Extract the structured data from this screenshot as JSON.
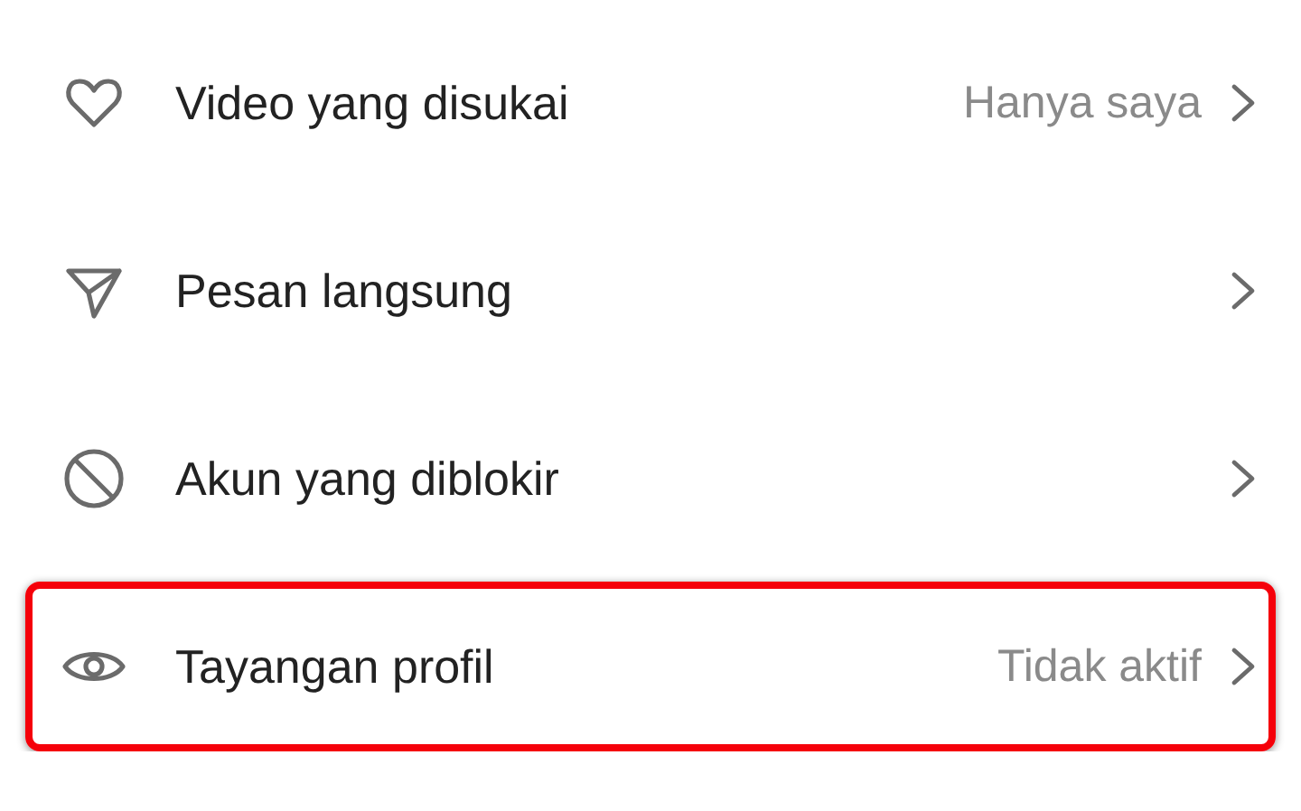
{
  "settings_items": [
    {
      "kind": "heart",
      "label": "Video yang disukai",
      "value": "Hanya saya",
      "highlighted": false
    },
    {
      "kind": "send",
      "label": "Pesan langsung",
      "highlighted": false
    },
    {
      "kind": "block",
      "label": "Akun yang diblokir",
      "highlighted": false
    },
    {
      "kind": "eye",
      "label": "Tayangan profil",
      "value": "Tidak aktif",
      "highlighted": true
    }
  ]
}
